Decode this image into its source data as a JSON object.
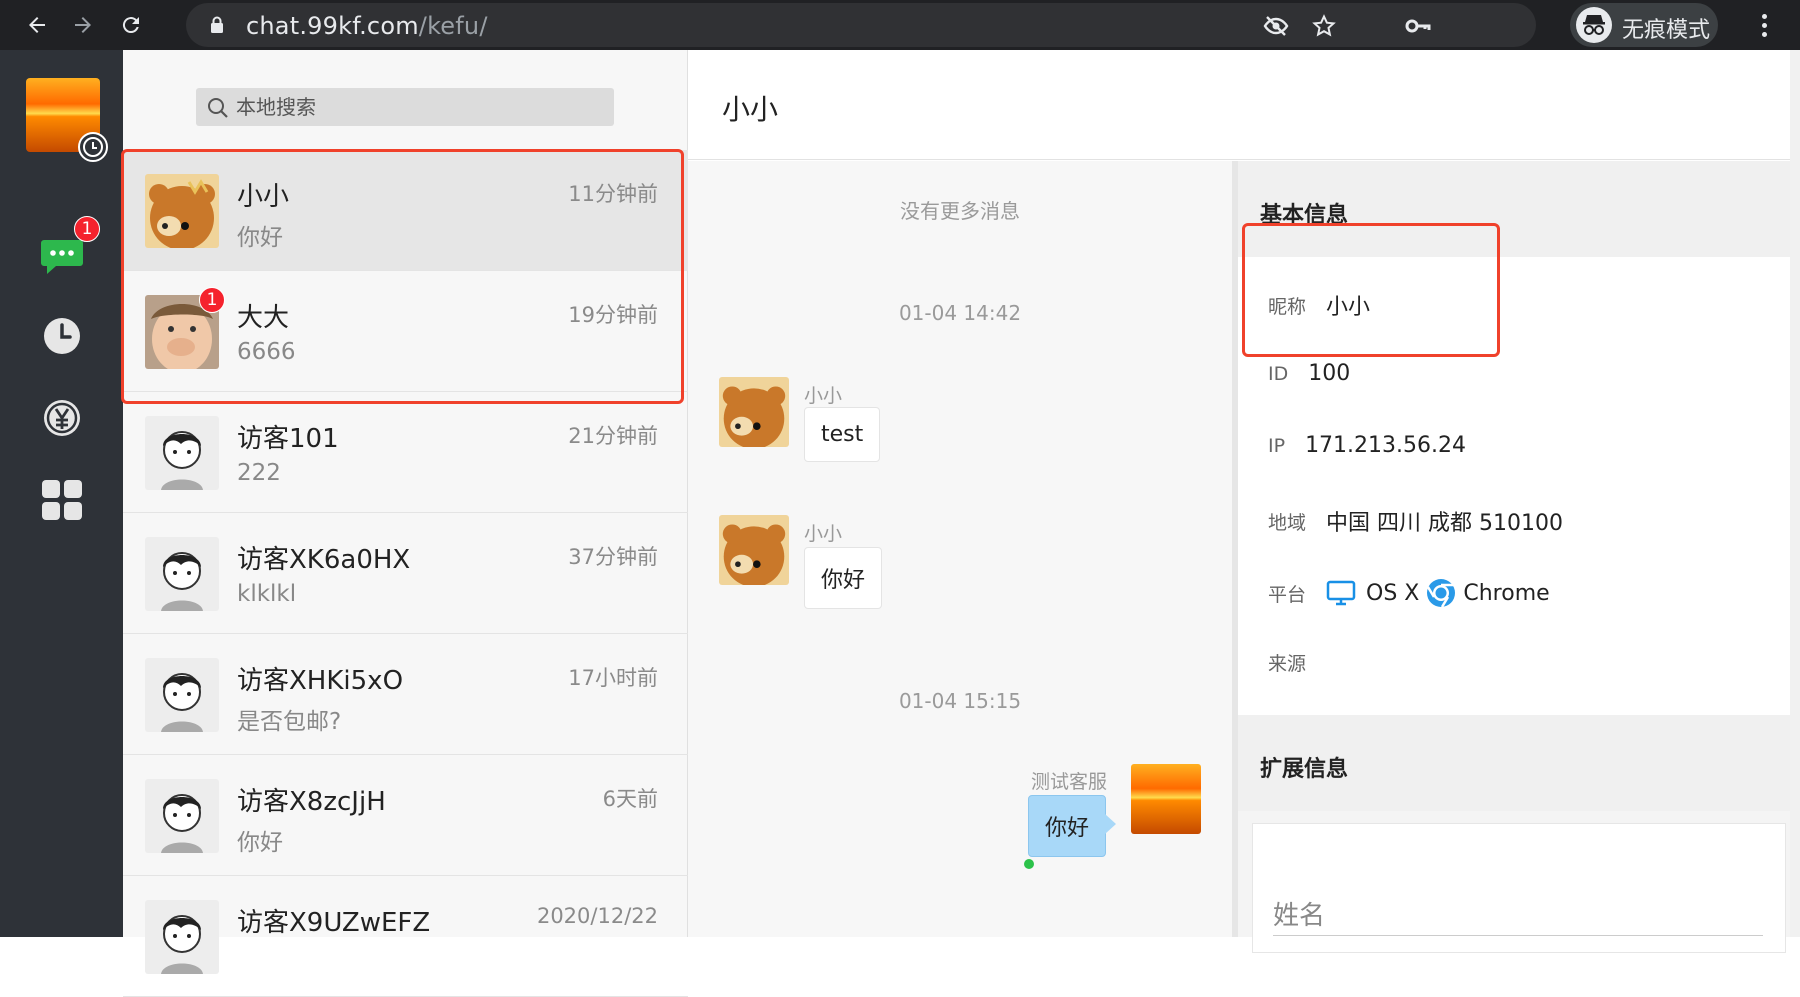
{
  "browser": {
    "url_host": "chat.99kf.com",
    "url_path": "/kefu/",
    "incognito_label": "无痕模式"
  },
  "rail": {
    "messages_badge": "1"
  },
  "search": {
    "placeholder": "本地搜索"
  },
  "conversations": [
    {
      "name": "小小",
      "preview": "你好",
      "time": "11分钟前",
      "avatar": "bear",
      "active": true
    },
    {
      "name": "大大",
      "preview": "6666",
      "time": "19分钟前",
      "avatar": "child",
      "badge": "1"
    },
    {
      "name": "访客101",
      "preview": "222",
      "time": "21分钟前",
      "avatar": "guest"
    },
    {
      "name": "访客XK6a0HX",
      "preview": "klklkl",
      "time": "37分钟前",
      "avatar": "guest"
    },
    {
      "name": "访客XHKi5xO",
      "preview": "是否包邮?",
      "time": "17小时前",
      "avatar": "guest"
    },
    {
      "name": "访客X8zcJjH",
      "preview": "你好",
      "time": "6天前",
      "avatar": "guest"
    },
    {
      "name": "访客X9UZwEFZ",
      "preview": "",
      "time": "2020/12/22",
      "avatar": "guest"
    }
  ],
  "chat": {
    "title": "小小",
    "no_more": "没有更多消息",
    "time1": "01-04 14:42",
    "time2": "01-04 15:15",
    "messages": [
      {
        "sender": "小小",
        "text": "test"
      },
      {
        "sender": "小小",
        "text": "你好"
      },
      {
        "sender": "测试客服",
        "text": "你好"
      }
    ]
  },
  "info": {
    "basic_title": "基本信息",
    "nickname_label": "昵称",
    "nickname": "小小",
    "id_label": "ID",
    "id": "100",
    "ip_label": "IP",
    "ip": "171.213.56.24",
    "region_label": "地域",
    "region": "中国 四川 成都 510100",
    "platform_label": "平台",
    "os": "OS X",
    "browser": "Chrome",
    "source_label": "来源",
    "ext_title": "扩展信息",
    "name_placeholder": "姓名"
  },
  "colors": {
    "highlight": "#f0412b",
    "badge": "#f5222d",
    "mine_bubble": "#a8d8f8",
    "rail": "#2e3238"
  }
}
